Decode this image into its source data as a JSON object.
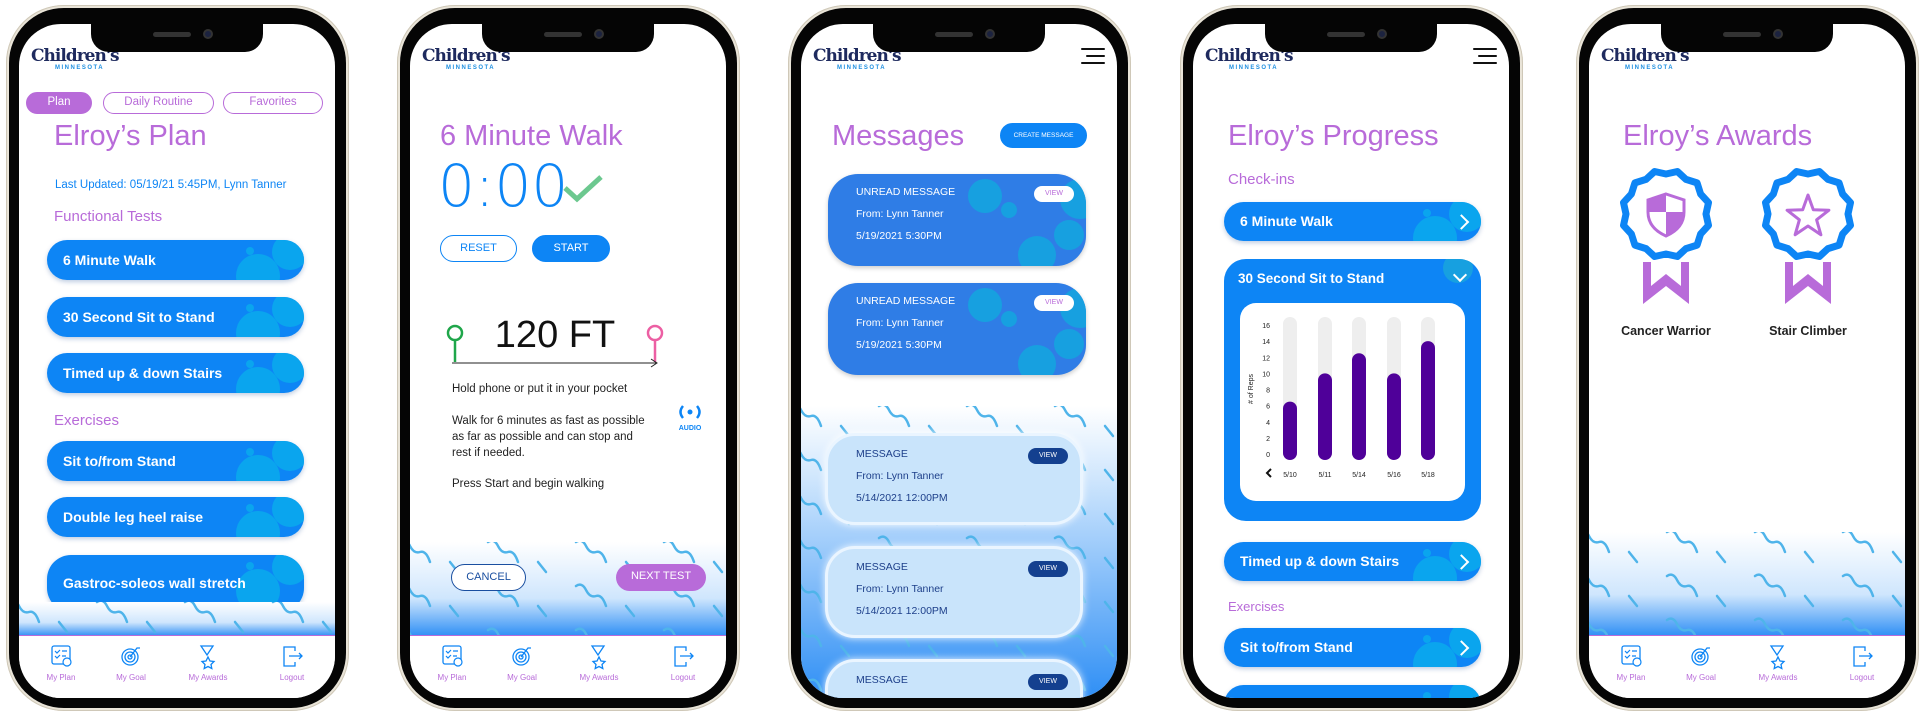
{
  "colors": {
    "brand_purple": "#b86bd9",
    "brand_blue": "#0d85f5",
    "bar_purple": "#4f0099",
    "navy": "#1e2a5e"
  },
  "logo": {
    "name": "Children's",
    "sub": "MINNESOTA"
  },
  "nav": {
    "items": [
      {
        "label": "My Plan",
        "icon": "checklist-clock-icon"
      },
      {
        "label": "My Goal",
        "icon": "target-icon"
      },
      {
        "label": "My Awards",
        "icon": "medal-icon"
      },
      {
        "label": "Logout",
        "icon": "logout-icon"
      }
    ]
  },
  "plan_screen": {
    "tabs": [
      {
        "label": "Plan",
        "active": true
      },
      {
        "label": "Daily Routine",
        "active": false
      },
      {
        "label": "Favorites",
        "active": false
      }
    ],
    "title": "Elroy’s Plan",
    "last_updated": "Last Updated: 05/19/21 5:45PM, Lynn Tanner",
    "functional_tests_label": "Functional Tests",
    "functional_tests": [
      "6 Minute Walk",
      "30 Second Sit to Stand",
      "Timed up & down Stairs"
    ],
    "exercises_label": "Exercises",
    "exercises": [
      "Sit to/from Stand",
      "Double leg heel raise",
      "Gastroc-soleos wall stretch"
    ]
  },
  "walk_screen": {
    "title": "6 Minute Walk",
    "timer": "0:00",
    "reset_label": "RESET",
    "start_label": "START",
    "distance": "120 FT",
    "audio_label": "AUDIO",
    "instructions": [
      "Hold phone or put it in your pocket",
      "Walk for 6 minutes as fast as possible as far as possible and can stop and rest if needed.",
      "Press Start and begin walking"
    ],
    "cancel_label": "CANCEL",
    "next_label": "NEXT TEST"
  },
  "messages_screen": {
    "title": "Messages",
    "create_label": "CREATE MESSAGE",
    "messages": [
      {
        "status": "UNREAD MESSAGE",
        "from": "From: Lynn Tanner",
        "date": "5/19/2021 5:30PM",
        "view": "VIEW",
        "unread": true
      },
      {
        "status": "UNREAD MESSAGE",
        "from": "From: Lynn Tanner",
        "date": "5/19/2021 5:30PM",
        "view": "VIEW",
        "unread": true
      },
      {
        "status": "MESSAGE",
        "from": "From: Lynn Tanner",
        "date": "5/14/2021 12:00PM",
        "view": "VIEW",
        "unread": false
      },
      {
        "status": "MESSAGE",
        "from": "From: Lynn Tanner",
        "date": "5/14/2021 12:00PM",
        "view": "VIEW",
        "unread": false
      },
      {
        "status": "MESSAGE",
        "from": "",
        "date": "",
        "view": "VIEW",
        "unread": false
      }
    ]
  },
  "progress_screen": {
    "title": "Elroy’s Progress",
    "checkins_label": "Check-ins",
    "checkin_1": "6 Minute Walk",
    "expanded_title": "30 Second Sit to Stand",
    "checkin_3": "Timed up & down Stairs",
    "exercises_label": "Exercises",
    "exercise_1": "Sit to/from Stand"
  },
  "chart_data": {
    "type": "bar",
    "ylabel": "# of Reps",
    "xlabel": "",
    "categories": [
      "5/10",
      "5/11",
      "5/14",
      "5/16",
      "5/18"
    ],
    "values": [
      6.5,
      10,
      12.5,
      10,
      14
    ],
    "ylim": [
      0,
      16
    ],
    "yticks": [
      0,
      2,
      4,
      6,
      8,
      10,
      12,
      14,
      16
    ],
    "grid": false
  },
  "awards_screen": {
    "title": "Elroy’s Awards",
    "awards": [
      {
        "label": "Cancer Warrior",
        "icon": "shield-icon"
      },
      {
        "label": "Stair Climber",
        "icon": "star-icon"
      }
    ]
  }
}
